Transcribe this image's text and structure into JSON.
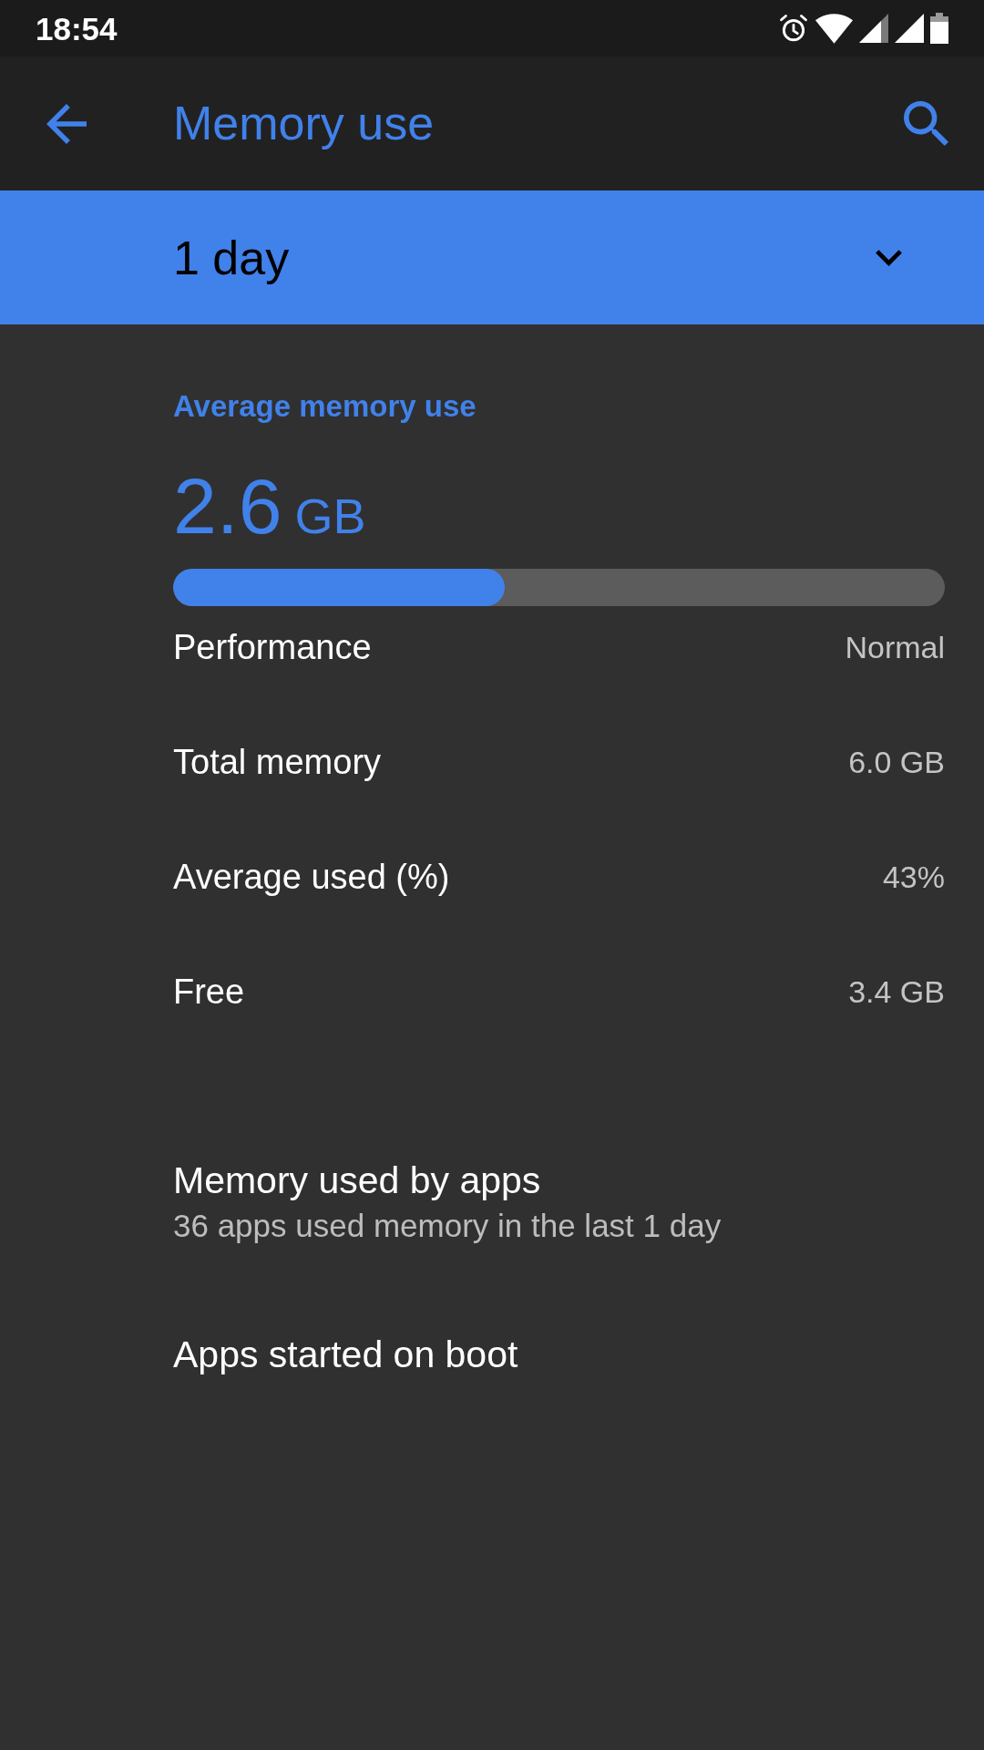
{
  "status_bar": {
    "time": "18:54"
  },
  "toolbar": {
    "title": "Memory use"
  },
  "period_selector": {
    "value": "1 day"
  },
  "summary": {
    "heading": "Average memory use",
    "value": "2.6",
    "unit": "GB",
    "level": 0.43
  },
  "stats": [
    {
      "label": "Performance",
      "value": "Normal"
    },
    {
      "label": "Total memory",
      "value": "6.0 GB"
    },
    {
      "label": "Average used (%)",
      "value": "43%"
    },
    {
      "label": "Free",
      "value": "3.4 GB"
    }
  ],
  "items": [
    {
      "title": "Memory used by apps",
      "summary": "36 apps used memory in the last 1 day"
    },
    {
      "title": "Apps started on boot"
    }
  ]
}
